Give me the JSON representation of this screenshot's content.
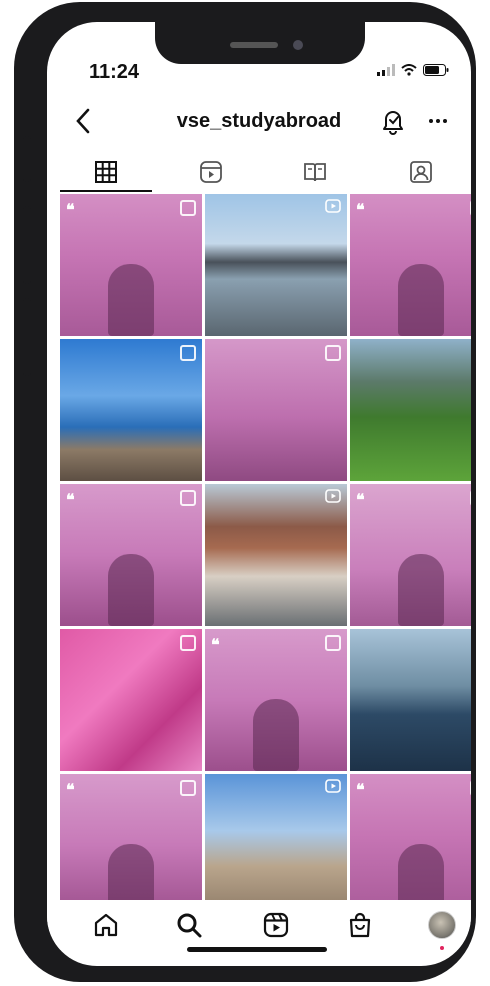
{
  "status_bar": {
    "time": "11:24"
  },
  "profile": {
    "username": "vse_studyabroad"
  },
  "tabs": [
    {
      "name": "tab-posts-grid",
      "icon": "grid-icon",
      "active": true
    },
    {
      "name": "tab-reels",
      "icon": "reels-icon",
      "active": false
    },
    {
      "name": "tab-guides",
      "icon": "guide-book-icon",
      "active": false
    },
    {
      "name": "tab-tagged",
      "icon": "tagged-person-icon",
      "active": false
    }
  ],
  "posts": [
    {
      "kind": "multi",
      "style": "pink-portrait",
      "has_quote": true
    },
    {
      "kind": "reel",
      "style": "mountain-beach",
      "has_quote": false
    },
    {
      "kind": "multi",
      "style": "pink-portrait",
      "has_quote": true
    },
    {
      "kind": "multi",
      "style": "sea-rocks",
      "has_quote": false
    },
    {
      "kind": "multi",
      "style": "pink-bridge",
      "has_quote": false
    },
    {
      "kind": "none",
      "style": "green-meadow",
      "has_quote": false
    },
    {
      "kind": "multi",
      "style": "pink-group",
      "has_quote": true
    },
    {
      "kind": "reel",
      "style": "city-portrait",
      "has_quote": false
    },
    {
      "kind": "multi",
      "style": "pink-jump",
      "has_quote": true
    },
    {
      "kind": "multi",
      "style": "wings-mural",
      "has_quote": false
    },
    {
      "kind": "multi",
      "style": "pink-group",
      "has_quote": true
    },
    {
      "kind": "none",
      "style": "lake-portrait",
      "has_quote": false
    },
    {
      "kind": "multi",
      "style": "pink-group",
      "has_quote": true
    },
    {
      "kind": "reel",
      "style": "city-view",
      "has_quote": false
    },
    {
      "kind": "multi",
      "style": "pink-portrait",
      "has_quote": true
    }
  ],
  "bottom_nav": [
    {
      "name": "nav-home",
      "icon": "home-icon"
    },
    {
      "name": "nav-search",
      "icon": "search-icon"
    },
    {
      "name": "nav-reels",
      "icon": "reels-icon"
    },
    {
      "name": "nav-shop",
      "icon": "shopping-bag-icon"
    },
    {
      "name": "nav-profile",
      "icon": "profile-avatar"
    }
  ],
  "colors": {
    "accent_pink": "#c36ba8",
    "pink_light": "#d98fc6",
    "notification_dot": "#e0245e"
  }
}
